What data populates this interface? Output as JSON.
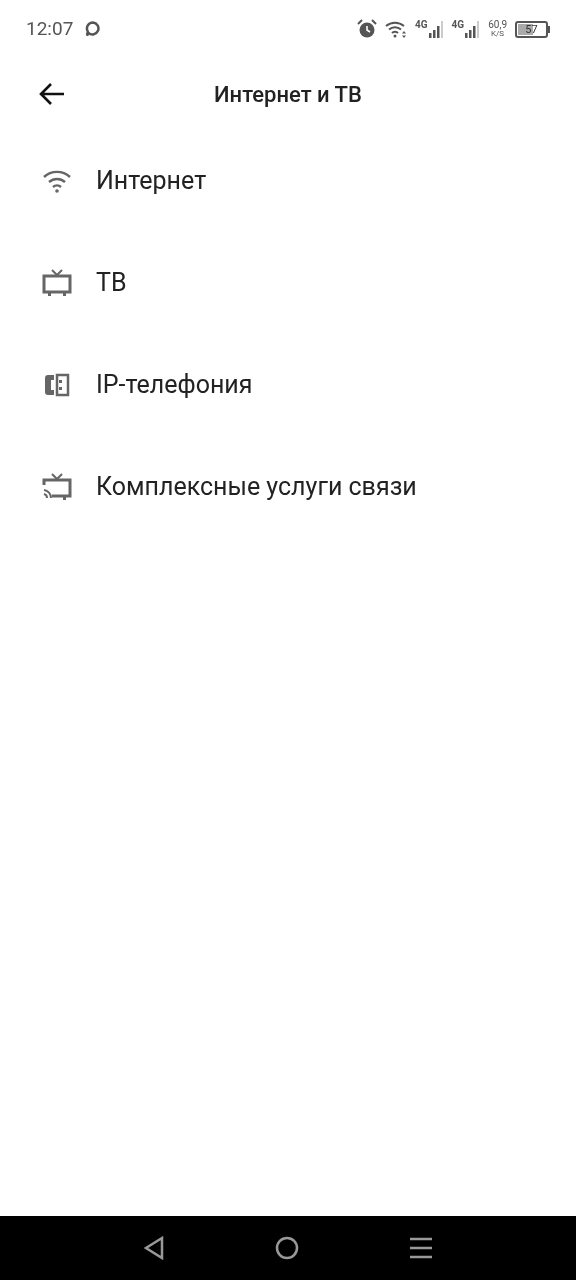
{
  "status_bar": {
    "time": "12:07",
    "networks": [
      {
        "label": "4G"
      },
      {
        "label": "4G"
      }
    ],
    "speed": "60,9",
    "speed_unit": "K/S",
    "battery": "57"
  },
  "header": {
    "title": "Интернет и ТВ"
  },
  "items": [
    {
      "kind": "wifi",
      "label": "Интернет"
    },
    {
      "kind": "tv",
      "label": "ТВ"
    },
    {
      "kind": "phone",
      "label": "IP-телефония"
    },
    {
      "kind": "cast",
      "label": "Комплексные услуги связи"
    }
  ]
}
